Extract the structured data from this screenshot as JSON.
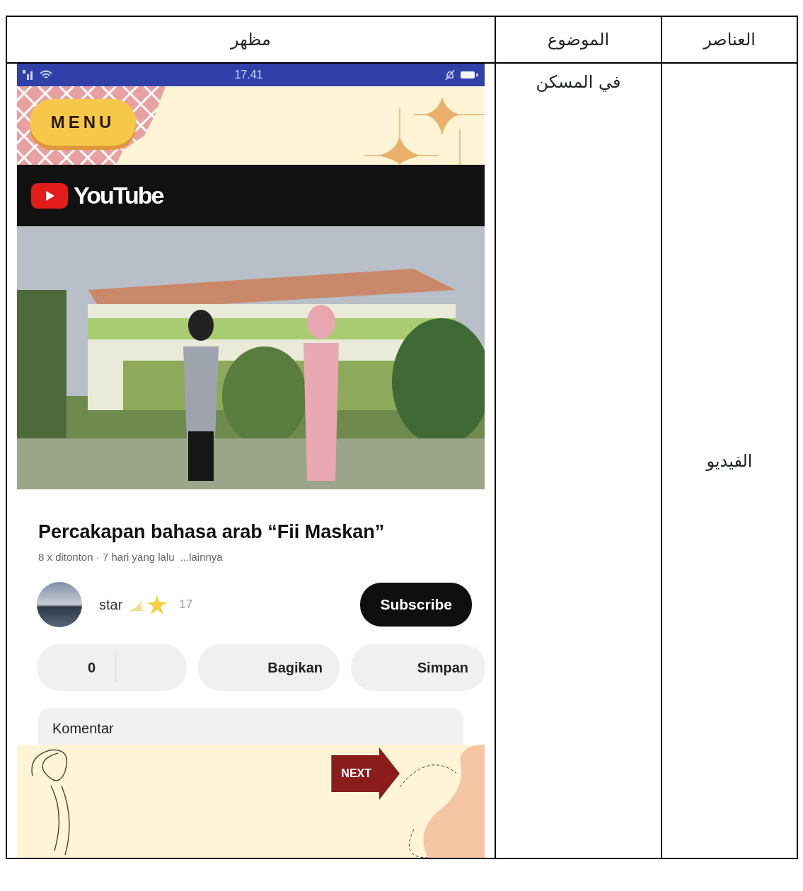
{
  "table": {
    "columns": [
      "العناصر",
      "الموضوع",
      "مظهر"
    ],
    "rows": [
      {
        "element": "الفيديو",
        "topic": "في المسكن",
        "view": {
          "status_bar": {
            "time": "17.41"
          },
          "menu_button": {
            "label": "MENU"
          },
          "app_bar": {
            "logo_text": "YouTube"
          },
          "title": "Percakapan bahasa arab “Fii Maskan”",
          "meta": "8 x ditonton · 7 hari yang lalu",
          "more_link": "...lainnya",
          "channel": {
            "name": "star",
            "subscribers": "17"
          },
          "subscribe_button": "Subscribe",
          "actions": [
            "0",
            "Bagikan",
            "Simpan"
          ],
          "comments": {
            "label": "Komentar"
          },
          "next_button": "NEXT"
        }
      }
    ]
  }
}
